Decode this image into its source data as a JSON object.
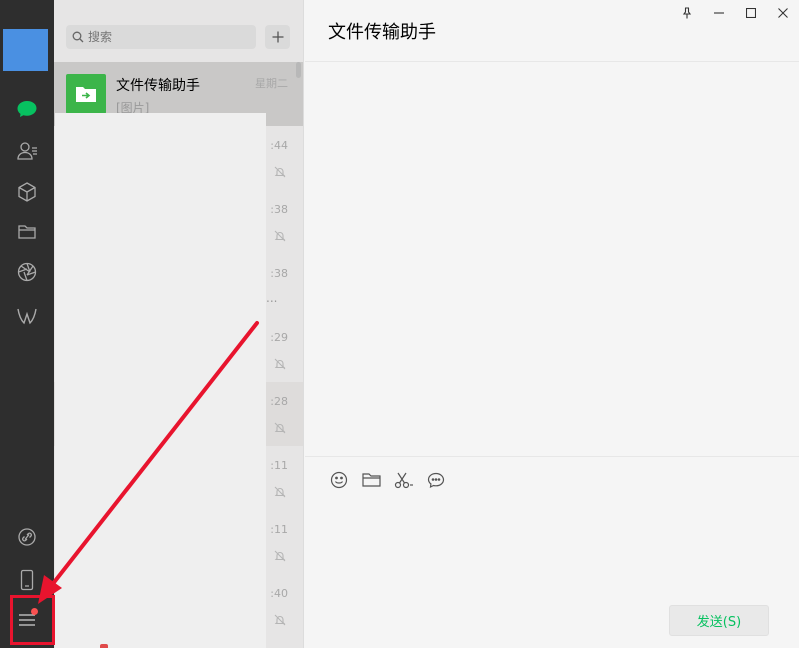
{
  "sidebar": {
    "items": [
      {
        "icon": "chat-icon",
        "active": true
      },
      {
        "icon": "contacts-icon"
      },
      {
        "icon": "favorites-cube-icon"
      },
      {
        "icon": "folder-icon"
      },
      {
        "icon": "moments-aperture-icon"
      },
      {
        "icon": "mini-program-icon"
      }
    ],
    "bottom_items": [
      {
        "icon": "link-icon"
      },
      {
        "icon": "phone-icon"
      },
      {
        "icon": "menu-icon",
        "has_badge": true
      }
    ]
  },
  "search": {
    "placeholder": "搜索"
  },
  "add_button_label": "+",
  "chat_list": [
    {
      "name": "文件传输助手",
      "preview": "[图片]",
      "time": "星期二",
      "active": true
    },
    {
      "time": ":44",
      "muted": true
    },
    {
      "time": ":38",
      "muted": true
    },
    {
      "time": ":38",
      "extra": "..."
    },
    {
      "time": ":29",
      "muted": true
    },
    {
      "time": ":28",
      "muted": true,
      "hover": true
    },
    {
      "time": ":11",
      "muted": true
    },
    {
      "time": ":11",
      "muted": true
    },
    {
      "time": ":40",
      "muted": true
    }
  ],
  "main": {
    "title": "文件传输助手",
    "window_controls": [
      "pin-icon",
      "minimize-icon",
      "maximize-icon",
      "close-icon"
    ],
    "toolbar": [
      "emoji-icon",
      "file-folder-icon",
      "screenshot-scissors-icon",
      "chat-history-icon"
    ],
    "send_label": "发送(S)"
  },
  "colors": {
    "sidebar_bg": "#2e2e2e",
    "accent_green": "#07c160",
    "annotation_red": "#e8142e"
  }
}
